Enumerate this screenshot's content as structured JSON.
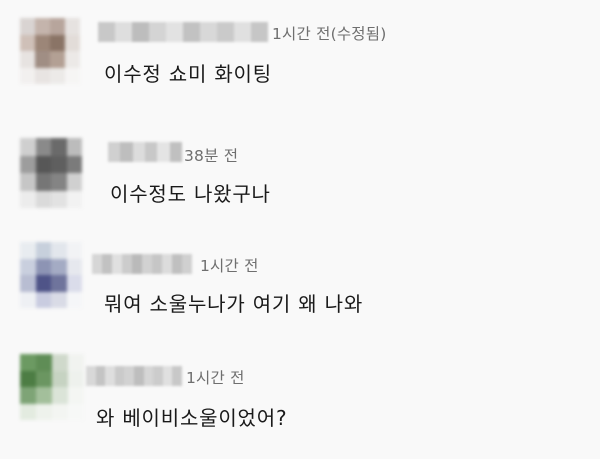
{
  "comments": [
    {
      "meta": "1시간 전(수정됨)",
      "text": "이수정 쇼미 화이팅",
      "avatar_colors": [
        "#d9d4d2",
        "#c4b4ac",
        "#b7a59c",
        "#e6e2e0",
        "#cfc0b8",
        "#9c8678",
        "#8a7466",
        "#e2dcd8",
        "#e7e3e1",
        "#a08e84",
        "#b3a094",
        "#ece9e7",
        "#f2f0ef",
        "#e8e4e2",
        "#eceae8",
        "#f6f5f4"
      ],
      "name_colors": [
        "#c8c8c8",
        "#dedede",
        "#bdbdbd",
        "#d4d4d4",
        "#e2e2e2",
        "#c2c2c2",
        "#d8d8d8",
        "#cacaca",
        "#e0e0e0",
        "#c6c6c6"
      ]
    },
    {
      "meta": "38분 전",
      "text": "이수정도 나왔구나",
      "avatar_colors": [
        "#cfcfcf",
        "#8a8a8a",
        "#6a6a6a",
        "#bcbcbc",
        "#9d9d9d",
        "#575757",
        "#5f5f5f",
        "#7b7b7b",
        "#c6c6c6",
        "#767676",
        "#848484",
        "#d0d0d0",
        "#ececec",
        "#dadada",
        "#e2e2e2",
        "#f2f2f2"
      ],
      "name_colors": [
        "#d0d0d0",
        "#bebebe",
        "#dcdcdc",
        "#c8c8c8",
        "#e4e4e4",
        "#c0c0c0"
      ]
    },
    {
      "meta": "1시간 전",
      "text": "뭐여 소울누나가 여기 왜 나와",
      "avatar_colors": [
        "#e8ecf0",
        "#c7d0dc",
        "#e2e6ec",
        "#f2f3f5",
        "#c9cfde",
        "#8d94b4",
        "#a4abc4",
        "#e6e8ee",
        "#b8bdd2",
        "#4f5488",
        "#6f749c",
        "#dadcea",
        "#eef0f4",
        "#c9cce0",
        "#d9dbe6",
        "#f5f6f8"
      ],
      "name_colors": [
        "#d6d6d6",
        "#c2c2c2",
        "#e0e0e0",
        "#cccccc",
        "#bababa",
        "#d2d2d2",
        "#c6c6c6",
        "#dcdcdc",
        "#c0c0c0",
        "#d0d0d0"
      ]
    },
    {
      "meta": "1시간 전",
      "text": "와 베이비소울이었어?",
      "avatar_colors": [
        "#6c9a62",
        "#5f8d56",
        "#cfd9cb",
        "#f1f3f0",
        "#4d7d44",
        "#6b9661",
        "#c6d3c2",
        "#eef1ed",
        "#7ea476",
        "#a3bf9b",
        "#dbe4d8",
        "#f4f6f3",
        "#e3ebe0",
        "#eef2ec",
        "#f3f5f2",
        "#f7f8f7"
      ],
      "name_colors": [
        "#d8d8d8",
        "#c4c4c4",
        "#dedede",
        "#cacaca",
        "#d2d2d2",
        "#bebebe",
        "#d6d6d6",
        "#cccccc",
        "#e0e0e0",
        "#c8c8c8"
      ]
    }
  ]
}
